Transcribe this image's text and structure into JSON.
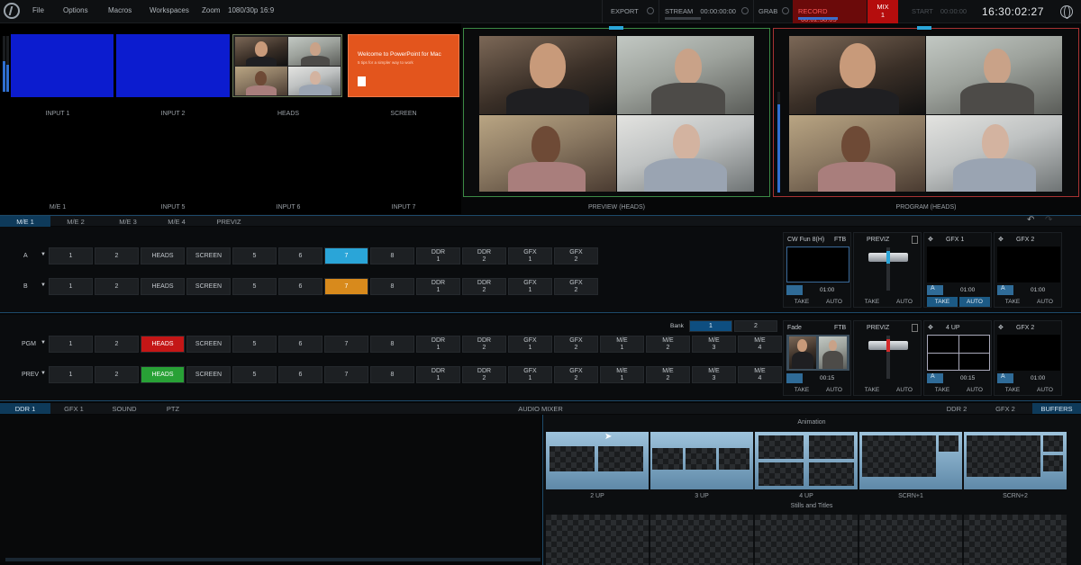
{
  "menu": {
    "items": [
      "File",
      "Options",
      "Macros",
      "Workspaces",
      "Zoom"
    ],
    "format": "1080/30p 16:9"
  },
  "toolbar": {
    "export": "EXPORT",
    "stream": "STREAM",
    "stream_time": "00:00:00:00",
    "grab": "GRAB",
    "record": "RECORD",
    "record_time": "00:02:58:05",
    "mix": "MIX",
    "mix_num": "1",
    "start": "START",
    "start_time": "00:00:00",
    "clock": "16:30:02:27"
  },
  "inputs": {
    "top": [
      "INPUT 1",
      "INPUT 2",
      "HEADS",
      "SCREEN"
    ],
    "bottom": [
      "M/E 1",
      "INPUT 5",
      "INPUT 6",
      "INPUT 7"
    ],
    "screen_slide": "Welcome to PowerPoint for Mac",
    "screen_sub": "5 tips for a simpler way to work"
  },
  "monitors": {
    "preview": "PREVIEW (HEADS)",
    "program": "PROGRAM (HEADS)"
  },
  "me_tabs": [
    "M/E 1",
    "M/E 2",
    "M/E 3",
    "M/E 4",
    "PREVIZ"
  ],
  "me1": {
    "row_a_label": "A",
    "row_b_label": "B",
    "buttons": [
      [
        "1"
      ],
      [
        "2"
      ],
      [
        "HEADS"
      ],
      [
        "SCREEN"
      ],
      [
        "5"
      ],
      [
        "6"
      ],
      [
        "7"
      ],
      [
        "8"
      ],
      [
        "DDR",
        "1"
      ],
      [
        "DDR",
        "2"
      ],
      [
        "GFX",
        "1"
      ],
      [
        "GFX",
        "2"
      ]
    ],
    "transition": {
      "name": "CW Fun 8(H)",
      "ftb": "FTB",
      "time": "01:00",
      "take": "TAKE",
      "auto": "AUTO"
    },
    "previz": {
      "label": "PREVIZ",
      "take": "TAKE",
      "auto": "AUTO"
    },
    "gfx1": {
      "label": "GFX 1",
      "time": "01:00",
      "take": "TAKE",
      "auto": "AUTO",
      "a": "A"
    },
    "gfx2": {
      "label": "GFX 2",
      "time": "01:00",
      "take": "TAKE",
      "auto": "AUTO",
      "a": "A"
    }
  },
  "main": {
    "pgm_label": "PGM",
    "prev_label": "PREV",
    "bank_label": "Bank",
    "banks": [
      "1",
      "2"
    ],
    "buttons": [
      [
        "1"
      ],
      [
        "2"
      ],
      [
        "HEADS"
      ],
      [
        "SCREEN"
      ],
      [
        "5"
      ],
      [
        "6"
      ],
      [
        "7"
      ],
      [
        "8"
      ],
      [
        "DDR",
        "1"
      ],
      [
        "DDR",
        "2"
      ],
      [
        "GFX",
        "1"
      ],
      [
        "GFX",
        "2"
      ],
      [
        "M/E",
        "1"
      ],
      [
        "M/E",
        "2"
      ],
      [
        "M/E",
        "3"
      ],
      [
        "M/E",
        "4"
      ]
    ],
    "transition": {
      "name": "Fade",
      "ftb": "FTB",
      "time": "00:15",
      "take": "TAKE",
      "auto": "AUTO"
    },
    "previz": {
      "label": "PREVIZ",
      "take": "TAKE",
      "auto": "AUTO"
    },
    "fourup": {
      "label": "4 UP",
      "time": "00:15",
      "take": "TAKE",
      "auto": "AUTO",
      "a": "A"
    },
    "gfx2": {
      "label": "GFX 2",
      "time": "01:00",
      "take": "TAKE",
      "auto": "AUTO",
      "a": "A"
    }
  },
  "bottom_tabs": {
    "left": [
      "DDR 1",
      "GFX 1",
      "SOUND",
      "PTZ"
    ],
    "center": "AUDIO MIXER",
    "right": [
      "DDR 2",
      "GFX 2",
      "BUFFERS"
    ]
  },
  "buffers": {
    "animation_title": "Animation",
    "animations": [
      "2 UP",
      "3 UP",
      "4 UP",
      "SCRN+1",
      "SCRN+2"
    ],
    "stills_title": "Stills and Titles"
  },
  "colors": {
    "accent": "#2aa5d8",
    "record": "#c41616",
    "preview_border": "#3c8a45",
    "program_border": "#a83232"
  }
}
